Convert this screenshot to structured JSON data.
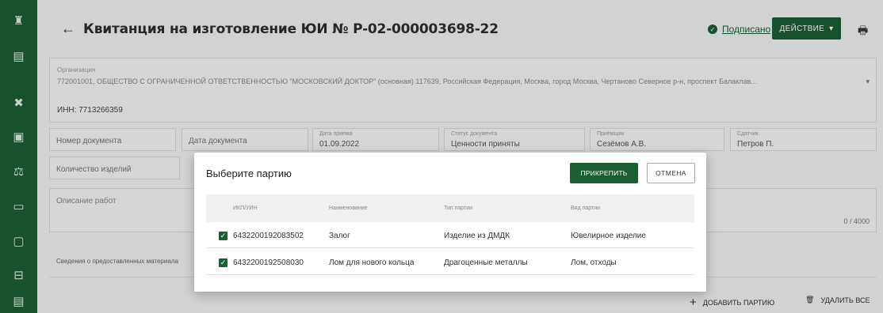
{
  "header": {
    "title": "Квитанция на изготовление ЮИ № P-02-000003698-22",
    "status": "Подписано",
    "action_label": "ДЕЙСТВИЕ",
    "action_caret": "▾"
  },
  "rail": {
    "icons": [
      "cart-icon",
      "list-icon",
      "tools-icon",
      "document-badge-icon",
      "scales-icon",
      "ticket-icon",
      "file-icon",
      "briefcase-icon",
      "doc-icon"
    ],
    "glyphs": [
      "♜",
      "▤",
      "✖",
      "▣",
      "⚖",
      "▭",
      "▢",
      "⊟",
      "▤"
    ]
  },
  "organization": {
    "label": "Организация",
    "value": "772001001, ОБЩЕСТВО С ОГРАНИЧЕННОЙ ОТВЕТСТВЕННОСТЬЮ \"МОСКОВСКИЙ ДОКТОР\" (основная) 117639, Российская Федерация, Москва, город Москва, Чертаново Северное р-н, проспект Балаклав...",
    "inn": "ИНН: 7713266359"
  },
  "fields": {
    "doc_number": "Номер документа",
    "doc_date": "Дата документа",
    "accept_date_caption": "Дата приема",
    "accept_date_value": "01.09.2022",
    "doc_status_caption": "Статус документа",
    "doc_status_value": "Ценности приняты",
    "receiver_caption": "Приёмщик",
    "receiver_value": "Сезёмов А.В.",
    "handover_caption": "Сдатчик",
    "handover_value": "Петров П.",
    "items_count": "Количество изделий",
    "work_description": "Описание работ",
    "counter": "0 / 4000"
  },
  "section": {
    "materials_label": "Сведения о предоставленных материала"
  },
  "footer": {
    "add_batch": "ДОБАВИТЬ ПАРТИЮ",
    "delete_all": "УДАЛИТЬ ВСЕ"
  },
  "modal": {
    "title": "Выберите партию",
    "attach": "ПРИКРЕПИТЬ",
    "cancel": "ОТМЕНА",
    "columns": [
      "ИКП/УИН",
      "Наименование",
      "Тип партии",
      "Вид партии"
    ],
    "rows": [
      {
        "checked": true,
        "id": "6432200192083502",
        "name": "Залог",
        "type": "Изделие из ДМДК",
        "kind": "Ювелирное изделие"
      },
      {
        "checked": true,
        "id": "6432200192508030",
        "name": "Лом для нового кольца",
        "type": "Драгоценные металлы",
        "kind": "Лом, отходы"
      }
    ]
  },
  "colors": {
    "brand": "#1b5e34",
    "rail": "#1b5e34"
  }
}
